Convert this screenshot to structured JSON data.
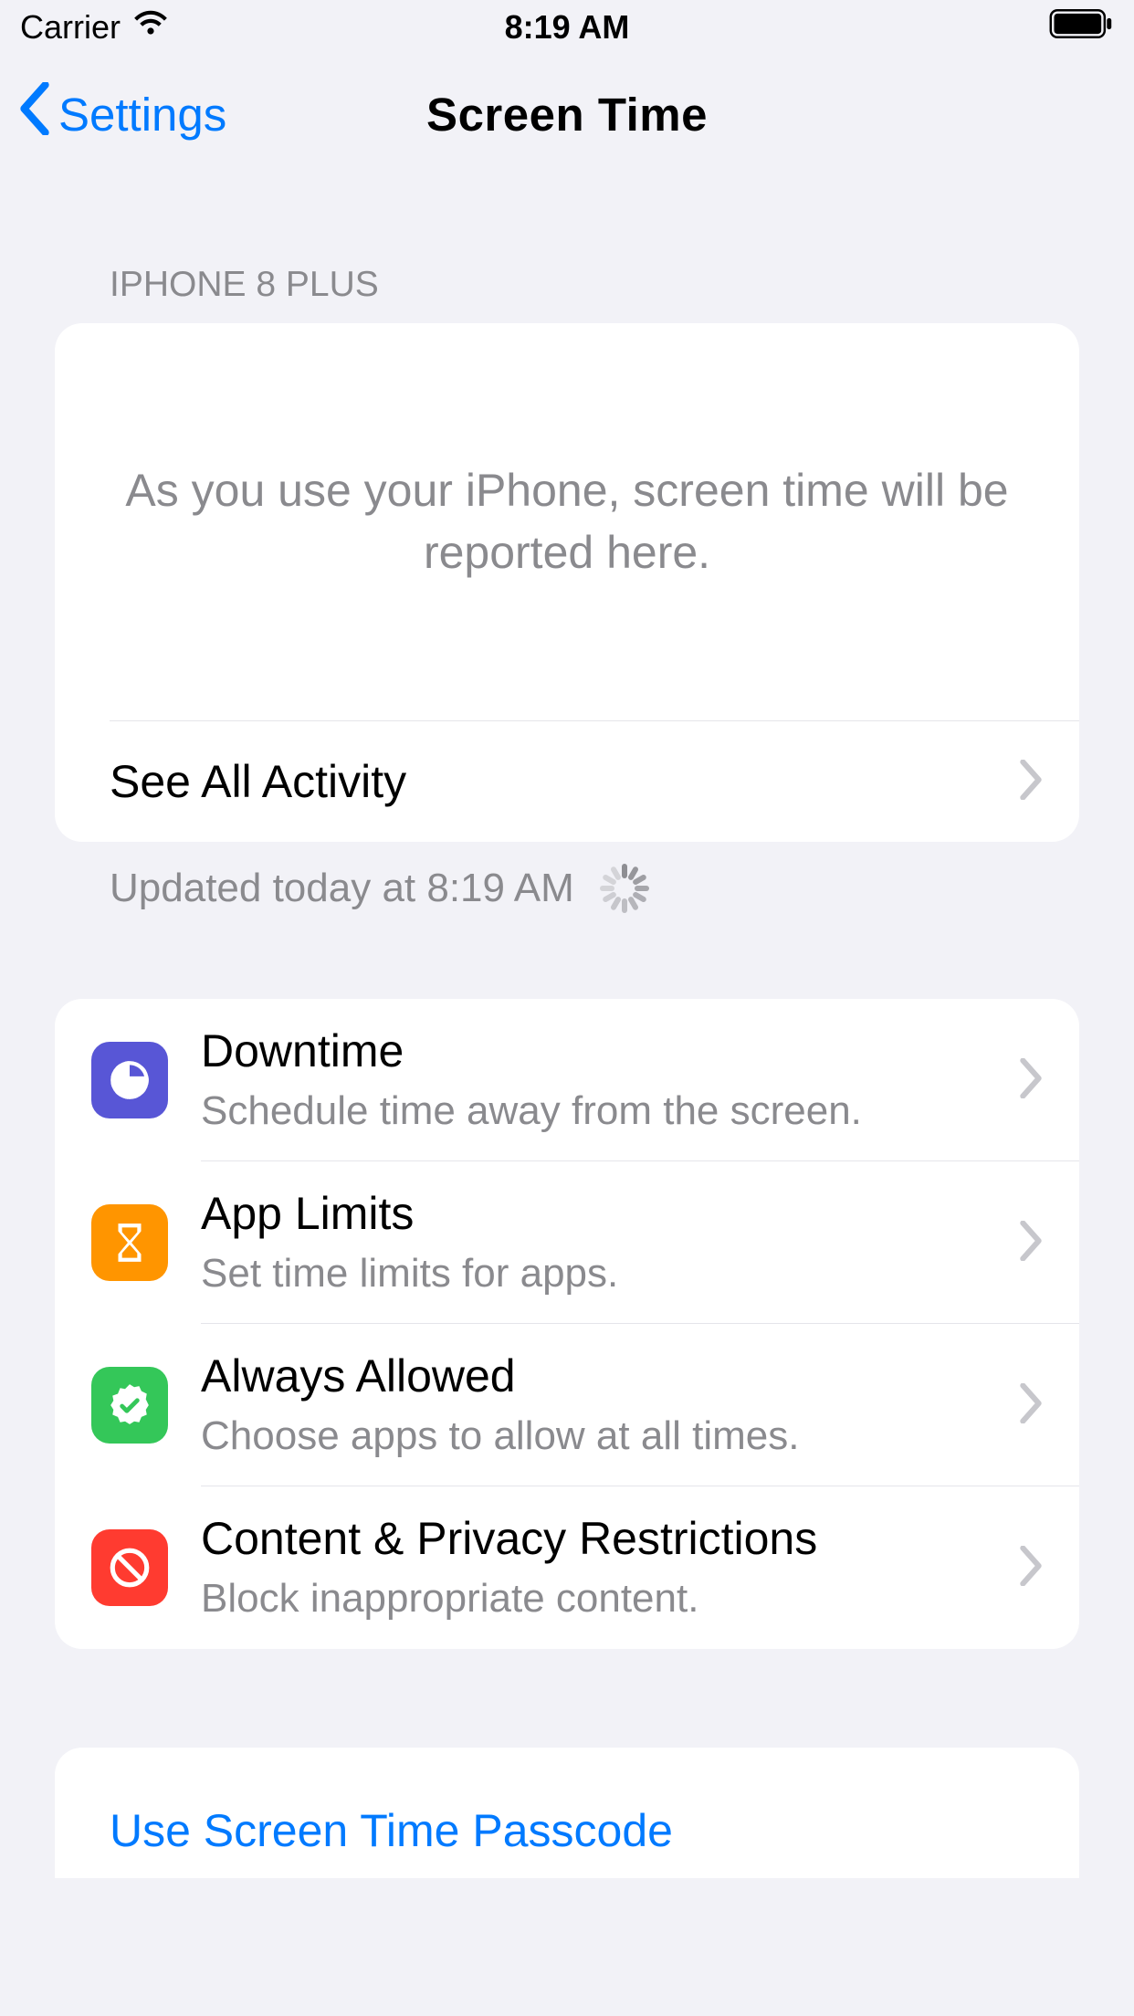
{
  "status": {
    "carrier": "Carrier",
    "time": "8:19 AM"
  },
  "nav": {
    "back_label": "Settings",
    "title": "Screen Time"
  },
  "device_section_header": "IPHONE 8 PLUS",
  "usage_empty_text": "As you use your iPhone, screen time will be reported here.",
  "see_all_label": "See All Activity",
  "updated_text": "Updated today at 8:19 AM",
  "options": [
    {
      "title": "Downtime",
      "subtitle": "Schedule time away from the screen.",
      "icon": "downtime-icon",
      "color": "#5856D6"
    },
    {
      "title": "App Limits",
      "subtitle": "Set time limits for apps.",
      "icon": "hourglass-icon",
      "color": "#FF9500"
    },
    {
      "title": "Always Allowed",
      "subtitle": "Choose apps to allow at all times.",
      "icon": "checkmark-seal-icon",
      "color": "#34C759"
    },
    {
      "title": "Content & Privacy Restrictions",
      "subtitle": "Block inappropriate content.",
      "icon": "nosign-icon",
      "color": "#FF3B30"
    }
  ],
  "passcode_label": "Use Screen Time Passcode"
}
